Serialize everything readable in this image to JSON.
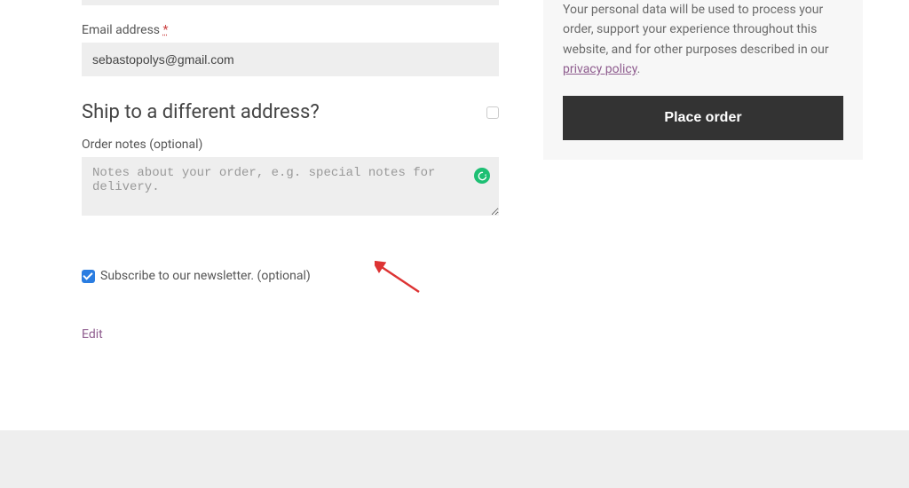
{
  "billing": {
    "email_label": "Email address ",
    "email_required_mark": "*",
    "email_value": "sebastopolys@gmail.com"
  },
  "shipping": {
    "heading": "Ship to a different address?",
    "notes_label": "Order notes (optional)",
    "notes_placeholder": "Notes about your order, e.g. special notes for delivery."
  },
  "newsletter": {
    "label": "Subscribe to our newsletter. (optional)"
  },
  "edit_link": "Edit",
  "sidebar": {
    "privacy_text_before": "Your personal data will be used to process your order, support your experience throughout this website, and for other purposes described in our ",
    "privacy_link_text": "privacy policy",
    "privacy_text_after": ".",
    "place_order_label": "Place order"
  }
}
